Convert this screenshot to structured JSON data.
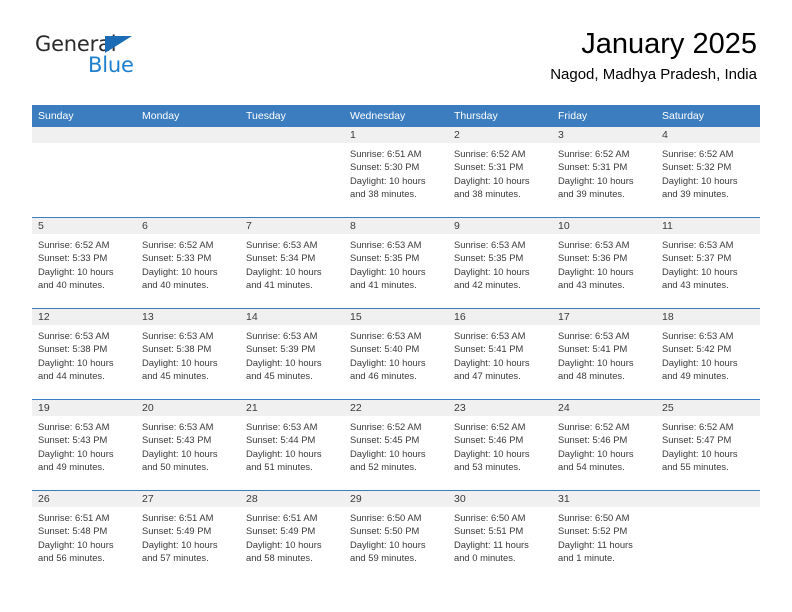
{
  "brand": {
    "name_part1": "General",
    "name_part2": "Blue",
    "accent_color": "#2080d0",
    "triangle_color": "#1b6cb5"
  },
  "header": {
    "month_title": "January 2025",
    "location": "Nagod, Madhya Pradesh, India"
  },
  "calendar": {
    "header_bg": "#3b7dbf",
    "daynum_bg": "#f0f0f0",
    "weekday_headers": [
      "Sunday",
      "Monday",
      "Tuesday",
      "Wednesday",
      "Thursday",
      "Friday",
      "Saturday"
    ],
    "weeks": [
      [
        {
          "day": "",
          "sunrise": "",
          "sunset": "",
          "daylight_line1": "",
          "daylight_line2": ""
        },
        {
          "day": "",
          "sunrise": "",
          "sunset": "",
          "daylight_line1": "",
          "daylight_line2": ""
        },
        {
          "day": "",
          "sunrise": "",
          "sunset": "",
          "daylight_line1": "",
          "daylight_line2": ""
        },
        {
          "day": "1",
          "sunrise": "Sunrise: 6:51 AM",
          "sunset": "Sunset: 5:30 PM",
          "daylight_line1": "Daylight: 10 hours",
          "daylight_line2": "and 38 minutes."
        },
        {
          "day": "2",
          "sunrise": "Sunrise: 6:52 AM",
          "sunset": "Sunset: 5:31 PM",
          "daylight_line1": "Daylight: 10 hours",
          "daylight_line2": "and 38 minutes."
        },
        {
          "day": "3",
          "sunrise": "Sunrise: 6:52 AM",
          "sunset": "Sunset: 5:31 PM",
          "daylight_line1": "Daylight: 10 hours",
          "daylight_line2": "and 39 minutes."
        },
        {
          "day": "4",
          "sunrise": "Sunrise: 6:52 AM",
          "sunset": "Sunset: 5:32 PM",
          "daylight_line1": "Daylight: 10 hours",
          "daylight_line2": "and 39 minutes."
        }
      ],
      [
        {
          "day": "5",
          "sunrise": "Sunrise: 6:52 AM",
          "sunset": "Sunset: 5:33 PM",
          "daylight_line1": "Daylight: 10 hours",
          "daylight_line2": "and 40 minutes."
        },
        {
          "day": "6",
          "sunrise": "Sunrise: 6:52 AM",
          "sunset": "Sunset: 5:33 PM",
          "daylight_line1": "Daylight: 10 hours",
          "daylight_line2": "and 40 minutes."
        },
        {
          "day": "7",
          "sunrise": "Sunrise: 6:53 AM",
          "sunset": "Sunset: 5:34 PM",
          "daylight_line1": "Daylight: 10 hours",
          "daylight_line2": "and 41 minutes."
        },
        {
          "day": "8",
          "sunrise": "Sunrise: 6:53 AM",
          "sunset": "Sunset: 5:35 PM",
          "daylight_line1": "Daylight: 10 hours",
          "daylight_line2": "and 41 minutes."
        },
        {
          "day": "9",
          "sunrise": "Sunrise: 6:53 AM",
          "sunset": "Sunset: 5:35 PM",
          "daylight_line1": "Daylight: 10 hours",
          "daylight_line2": "and 42 minutes."
        },
        {
          "day": "10",
          "sunrise": "Sunrise: 6:53 AM",
          "sunset": "Sunset: 5:36 PM",
          "daylight_line1": "Daylight: 10 hours",
          "daylight_line2": "and 43 minutes."
        },
        {
          "day": "11",
          "sunrise": "Sunrise: 6:53 AM",
          "sunset": "Sunset: 5:37 PM",
          "daylight_line1": "Daylight: 10 hours",
          "daylight_line2": "and 43 minutes."
        }
      ],
      [
        {
          "day": "12",
          "sunrise": "Sunrise: 6:53 AM",
          "sunset": "Sunset: 5:38 PM",
          "daylight_line1": "Daylight: 10 hours",
          "daylight_line2": "and 44 minutes."
        },
        {
          "day": "13",
          "sunrise": "Sunrise: 6:53 AM",
          "sunset": "Sunset: 5:38 PM",
          "daylight_line1": "Daylight: 10 hours",
          "daylight_line2": "and 45 minutes."
        },
        {
          "day": "14",
          "sunrise": "Sunrise: 6:53 AM",
          "sunset": "Sunset: 5:39 PM",
          "daylight_line1": "Daylight: 10 hours",
          "daylight_line2": "and 45 minutes."
        },
        {
          "day": "15",
          "sunrise": "Sunrise: 6:53 AM",
          "sunset": "Sunset: 5:40 PM",
          "daylight_line1": "Daylight: 10 hours",
          "daylight_line2": "and 46 minutes."
        },
        {
          "day": "16",
          "sunrise": "Sunrise: 6:53 AM",
          "sunset": "Sunset: 5:41 PM",
          "daylight_line1": "Daylight: 10 hours",
          "daylight_line2": "and 47 minutes."
        },
        {
          "day": "17",
          "sunrise": "Sunrise: 6:53 AM",
          "sunset": "Sunset: 5:41 PM",
          "daylight_line1": "Daylight: 10 hours",
          "daylight_line2": "and 48 minutes."
        },
        {
          "day": "18",
          "sunrise": "Sunrise: 6:53 AM",
          "sunset": "Sunset: 5:42 PM",
          "daylight_line1": "Daylight: 10 hours",
          "daylight_line2": "and 49 minutes."
        }
      ],
      [
        {
          "day": "19",
          "sunrise": "Sunrise: 6:53 AM",
          "sunset": "Sunset: 5:43 PM",
          "daylight_line1": "Daylight: 10 hours",
          "daylight_line2": "and 49 minutes."
        },
        {
          "day": "20",
          "sunrise": "Sunrise: 6:53 AM",
          "sunset": "Sunset: 5:43 PM",
          "daylight_line1": "Daylight: 10 hours",
          "daylight_line2": "and 50 minutes."
        },
        {
          "day": "21",
          "sunrise": "Sunrise: 6:53 AM",
          "sunset": "Sunset: 5:44 PM",
          "daylight_line1": "Daylight: 10 hours",
          "daylight_line2": "and 51 minutes."
        },
        {
          "day": "22",
          "sunrise": "Sunrise: 6:52 AM",
          "sunset": "Sunset: 5:45 PM",
          "daylight_line1": "Daylight: 10 hours",
          "daylight_line2": "and 52 minutes."
        },
        {
          "day": "23",
          "sunrise": "Sunrise: 6:52 AM",
          "sunset": "Sunset: 5:46 PM",
          "daylight_line1": "Daylight: 10 hours",
          "daylight_line2": "and 53 minutes."
        },
        {
          "day": "24",
          "sunrise": "Sunrise: 6:52 AM",
          "sunset": "Sunset: 5:46 PM",
          "daylight_line1": "Daylight: 10 hours",
          "daylight_line2": "and 54 minutes."
        },
        {
          "day": "25",
          "sunrise": "Sunrise: 6:52 AM",
          "sunset": "Sunset: 5:47 PM",
          "daylight_line1": "Daylight: 10 hours",
          "daylight_line2": "and 55 minutes."
        }
      ],
      [
        {
          "day": "26",
          "sunrise": "Sunrise: 6:51 AM",
          "sunset": "Sunset: 5:48 PM",
          "daylight_line1": "Daylight: 10 hours",
          "daylight_line2": "and 56 minutes."
        },
        {
          "day": "27",
          "sunrise": "Sunrise: 6:51 AM",
          "sunset": "Sunset: 5:49 PM",
          "daylight_line1": "Daylight: 10 hours",
          "daylight_line2": "and 57 minutes."
        },
        {
          "day": "28",
          "sunrise": "Sunrise: 6:51 AM",
          "sunset": "Sunset: 5:49 PM",
          "daylight_line1": "Daylight: 10 hours",
          "daylight_line2": "and 58 minutes."
        },
        {
          "day": "29",
          "sunrise": "Sunrise: 6:50 AM",
          "sunset": "Sunset: 5:50 PM",
          "daylight_line1": "Daylight: 10 hours",
          "daylight_line2": "and 59 minutes."
        },
        {
          "day": "30",
          "sunrise": "Sunrise: 6:50 AM",
          "sunset": "Sunset: 5:51 PM",
          "daylight_line1": "Daylight: 11 hours",
          "daylight_line2": "and 0 minutes."
        },
        {
          "day": "31",
          "sunrise": "Sunrise: 6:50 AM",
          "sunset": "Sunset: 5:52 PM",
          "daylight_line1": "Daylight: 11 hours",
          "daylight_line2": "and 1 minute."
        },
        {
          "day": "",
          "sunrise": "",
          "sunset": "",
          "daylight_line1": "",
          "daylight_line2": ""
        }
      ]
    ]
  }
}
